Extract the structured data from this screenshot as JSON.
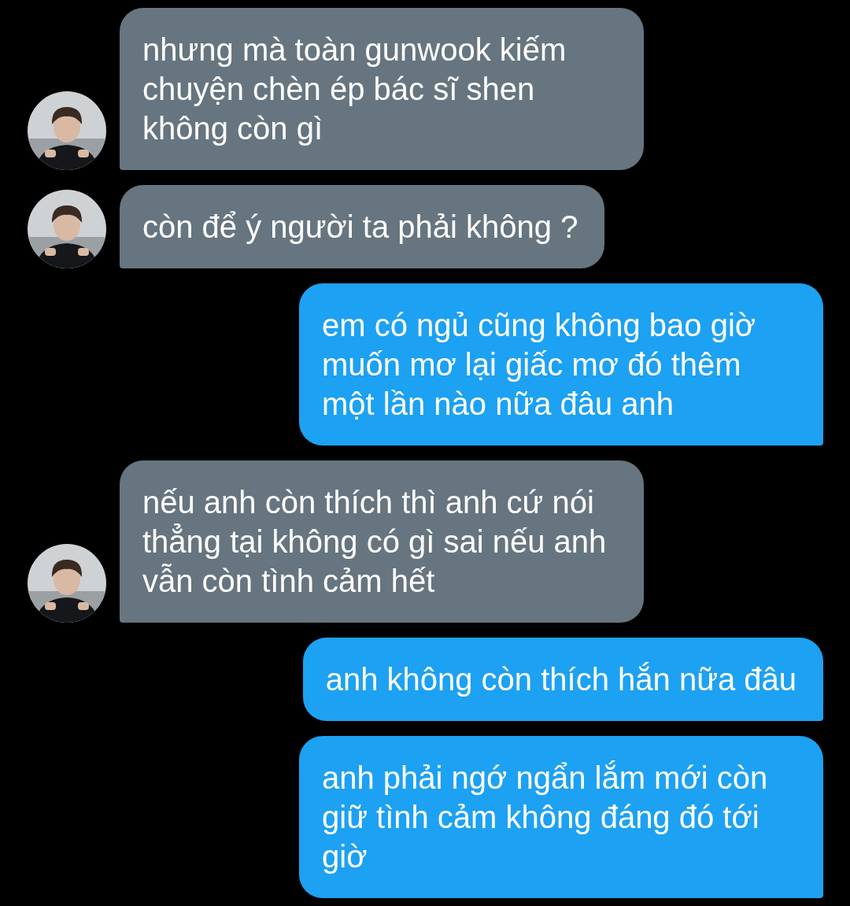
{
  "messages": [
    {
      "kind": "incoming",
      "text": "nhưng mà toàn gunwook kiếm chuyện chèn ép bác sĩ shen không còn gì"
    },
    {
      "kind": "incoming",
      "text": "còn để ý người ta phải không ?"
    },
    {
      "kind": "outgoing",
      "text": "em có ngủ cũng không bao giờ muốn mơ lại giấc mơ đó thêm một lần nào nữa đâu anh"
    },
    {
      "kind": "incoming",
      "text": "nếu anh còn thích thì anh cứ nói thẳng tại không có gì sai nếu anh vẫn còn tình cảm hết"
    },
    {
      "kind": "outgoing",
      "text": "anh không còn thích hắn nữa đâu"
    },
    {
      "kind": "outgoing",
      "text": "anh phải ngớ ngẩn lắm mới còn giữ tình cảm không đáng đó tới giờ"
    }
  ]
}
